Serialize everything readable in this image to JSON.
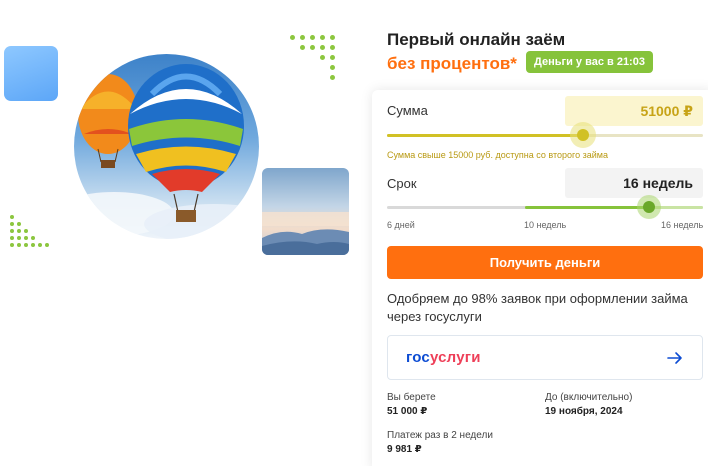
{
  "hero": {
    "images": [
      "hot-air-balloons-photo",
      "sky-horizon-photo"
    ]
  },
  "offer": {
    "title": "Первый онлайн заём",
    "subtitle": "без процентов*",
    "badge": "Деньги у вас в 21:03"
  },
  "calculator": {
    "sum": {
      "label": "Сумма",
      "value": "51000 ₽",
      "slider_fraction": 0.62,
      "hint": "Сумма свыше 15000 руб. доступна со второго займа"
    },
    "term": {
      "label": "Срок",
      "value": "16 недель",
      "slider_fraction": 0.83,
      "ticks": [
        "6 дней",
        "10 недель",
        "16 недель"
      ]
    },
    "submit_label": "Получить деньги"
  },
  "approval_text": "Одобряем до 98% заявок при оформлении займа через госуслуги",
  "gosuslugi": {
    "logo_part1": "гос",
    "logo_part2": "услуги",
    "arrow_icon": "arrow-right-icon"
  },
  "summary": {
    "borrow_label": "Вы берете",
    "borrow_value": "51 000 ₽",
    "until_label": "До (включительно)",
    "until_value": "19 ноября, 2024",
    "payment_label": "Платеж раз в 2 недели",
    "payment_value": "9 981 ₽"
  },
  "colors": {
    "accent_orange": "#ff6f0f",
    "accent_green": "#86c33b",
    "slider_yellow": "#d1c125",
    "gos_blue": "#0d4cd3",
    "gos_red": "#ee3f58"
  }
}
